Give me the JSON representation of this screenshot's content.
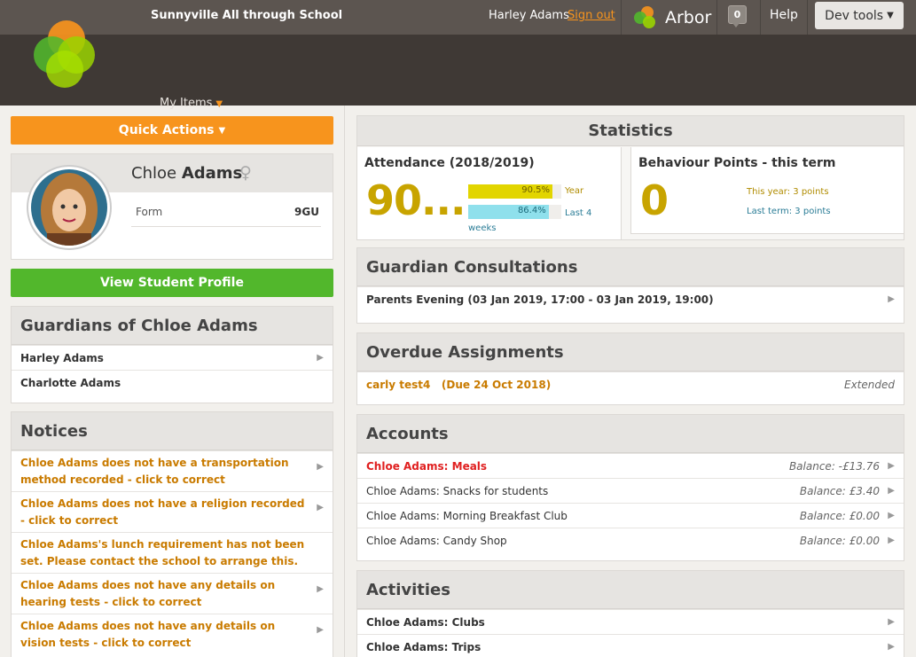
{
  "header": {
    "school_name": "Sunnyville All through School",
    "user_name": "Harley Adams",
    "sign_out": "Sign out",
    "brand": "Arbor",
    "notification_count": "0",
    "help": "Help",
    "dev_tools": "Dev tools",
    "nav_item": "My Items"
  },
  "sidebar": {
    "quick_actions": "Quick Actions",
    "student": {
      "first_name": "Chloe",
      "last_name": "Adams",
      "gender_icon": "female-icon",
      "form_label": "Form",
      "form_value": "9GU"
    },
    "view_profile": "View Student Profile",
    "guardians": {
      "title": "Guardians of Chloe Adams",
      "items": [
        "Harley Adams",
        "Charlotte Adams"
      ]
    },
    "notices": {
      "title": "Notices",
      "items": [
        "Chloe Adams does not have a transportation method recorded - click to correct",
        "Chloe Adams does not have a religion recorded - click to correct",
        "Chloe Adams's lunch requirement has not been set. Please contact the school to arrange this.",
        "Chloe Adams does not have any details on hearing tests - click to correct",
        "Chloe Adams does not have any details on vision tests - click to correct"
      ]
    }
  },
  "statistics": {
    "title": "Statistics",
    "attendance": {
      "title": "Attendance (2018/2019)",
      "big_value": "90....",
      "bars": [
        {
          "value": 90.5,
          "label": "90.5%",
          "caption": "Year",
          "color": "#e2d500"
        },
        {
          "value": 86.4,
          "label": "86.4%",
          "caption": "Last 4 weeks",
          "color": "#8fe0ec"
        }
      ]
    },
    "behaviour": {
      "title": "Behaviour Points - this term",
      "big_value": "0",
      "this_year": "This year: 3 points",
      "last_term": "Last term: 3 points"
    }
  },
  "consultations": {
    "title": "Guardian Consultations",
    "items": [
      "Parents Evening (03 Jan 2019, 17:00 - 03 Jan 2019, 19:00)"
    ]
  },
  "overdue": {
    "title": "Overdue Assignments",
    "items": [
      {
        "name": "carly test4   (Due 24 Oct 2018)",
        "status": "Extended"
      }
    ]
  },
  "accounts": {
    "title": "Accounts",
    "items": [
      {
        "name": "Chloe Adams: Meals",
        "balance": "Balance: -£13.76"
      },
      {
        "name": "Chloe Adams: Snacks for students",
        "balance": "Balance: £3.40"
      },
      {
        "name": "Chloe Adams: Morning Breakfast Club",
        "balance": "Balance: £0.00"
      },
      {
        "name": "Chloe Adams: Candy Shop",
        "balance": "Balance: £0.00"
      }
    ]
  },
  "activities": {
    "title": "Activities",
    "items": [
      "Chloe Adams: Clubs",
      "Chloe Adams: Trips"
    ]
  },
  "colors": {
    "accent_orange": "#f7941d",
    "accent_green": "#52b72c",
    "header_dark": "#3f3935",
    "attendance_gold": "#c8a400"
  }
}
